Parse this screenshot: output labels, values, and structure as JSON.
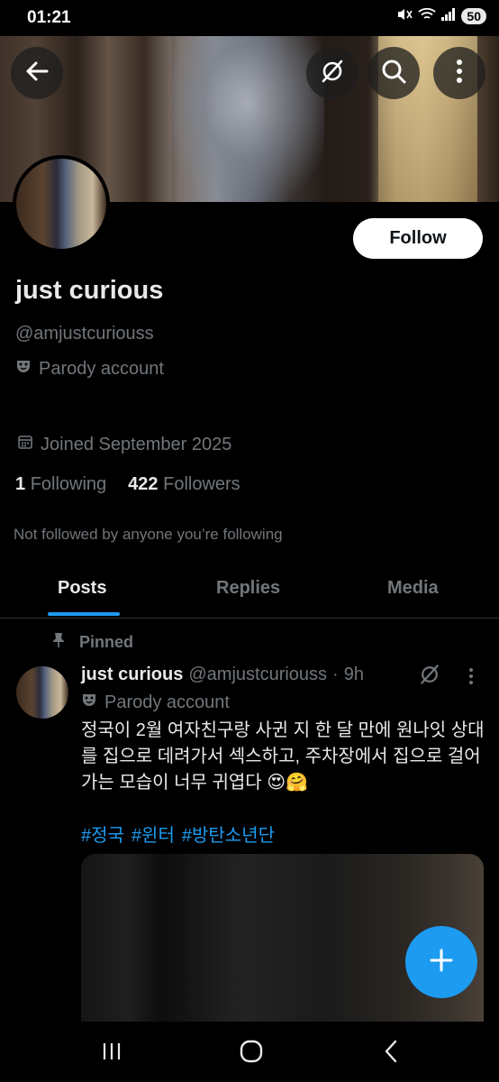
{
  "status_bar": {
    "time": "01:21",
    "battery": "50"
  },
  "profile": {
    "name": "just curious",
    "handle": "@amjustcuriouss",
    "parody_label": "Parody account",
    "joined": "Joined September 2025",
    "following_count": "1",
    "following_label": "Following",
    "followers_count": "422",
    "followers_label": "Followers",
    "not_followed_text": "Not followed by anyone you’re following",
    "follow_button": "Follow"
  },
  "tabs": [
    {
      "label": "Posts",
      "active": true
    },
    {
      "label": "Replies",
      "active": false
    },
    {
      "label": "Media",
      "active": false
    }
  ],
  "pinned_post": {
    "pinned_label": "Pinned",
    "author_name": "just curious",
    "author_handle": "@amjustcuriouss",
    "separator": "·",
    "time": "9h",
    "parody_label": "Parody account",
    "text_line1": "정국이 2월 여자친구랑 사귄 지 한 달 만에 원나잇 상대",
    "text_line2": "를 집으로 데려가서 섹스하고, 주차장에서 집으로 걸어",
    "text_line3": "가는 모습이 너무 귀엽다 😍🤗",
    "hashtags": [
      "#정국",
      "#윈터",
      "#방탄소년단"
    ]
  },
  "icons": {
    "back": "arrow-left-icon",
    "grok": "grok-icon",
    "search": "search-icon",
    "more": "more-vertical-icon",
    "calendar": "calendar-icon",
    "parody": "mask-icon",
    "pin": "pin-icon",
    "compose": "plus-icon"
  },
  "colors": {
    "accent": "#1d9bf0",
    "background": "#000000",
    "muted": "#71767b"
  }
}
